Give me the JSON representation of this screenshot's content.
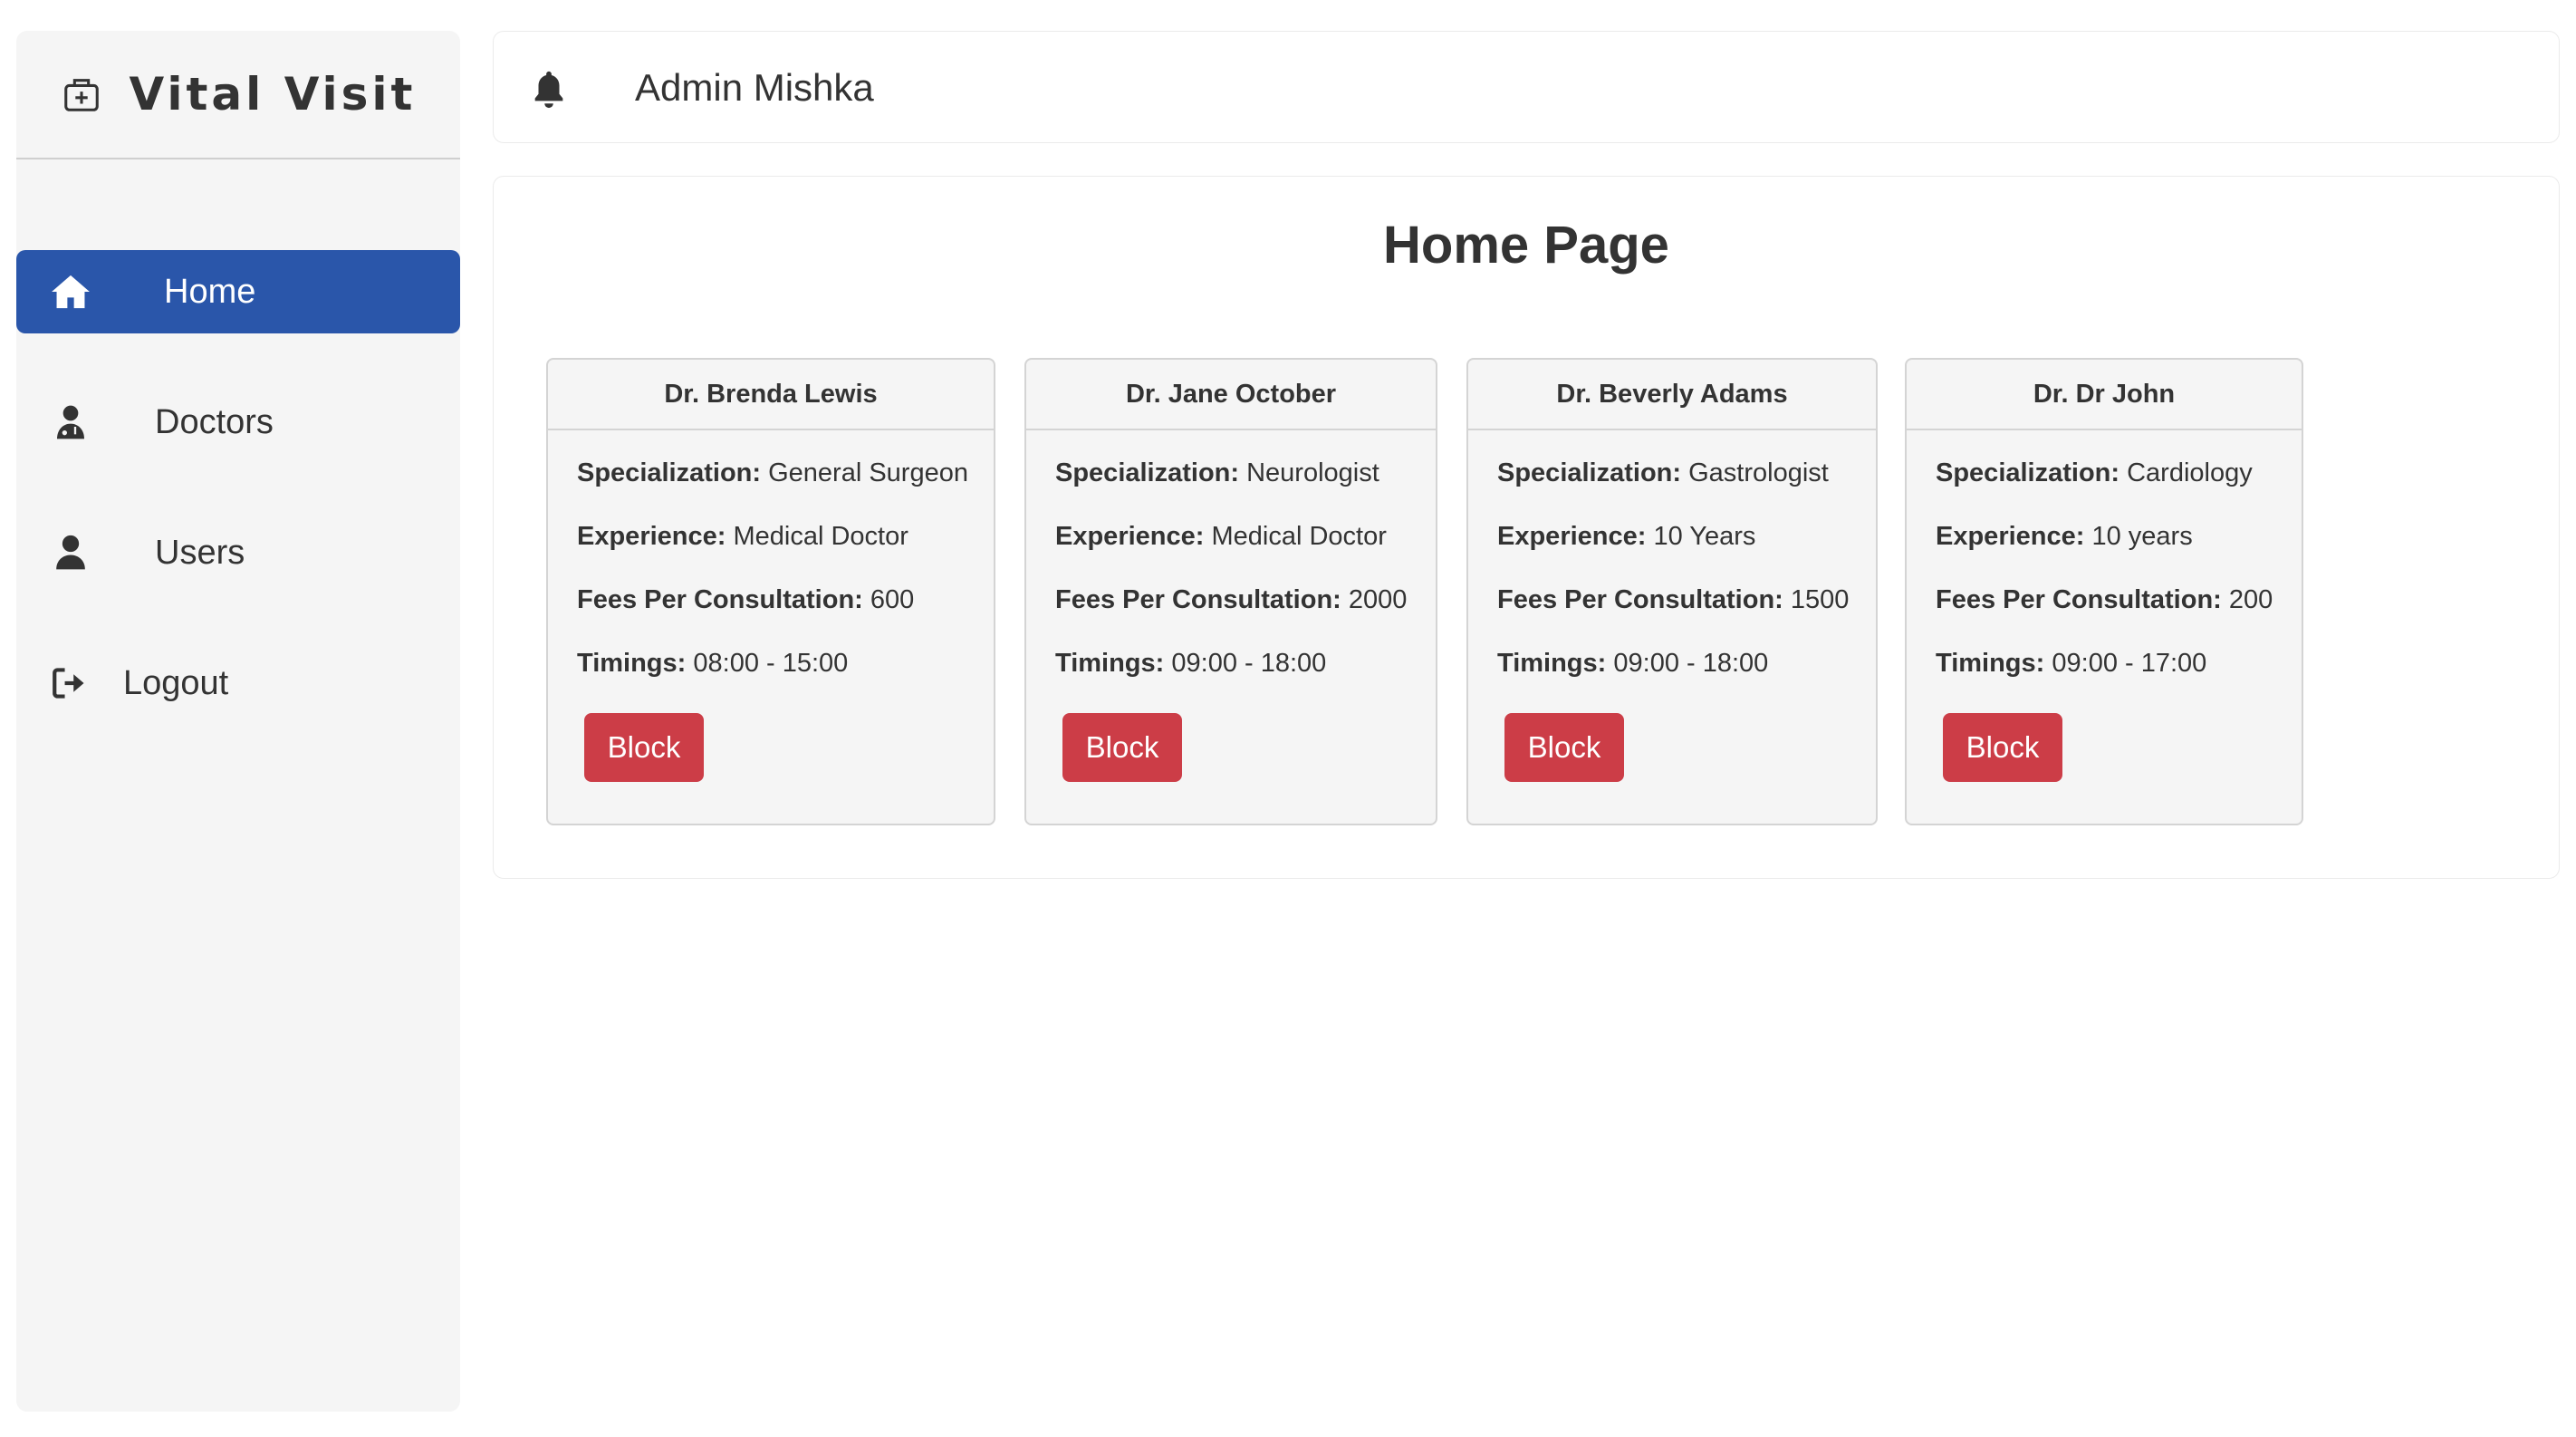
{
  "brand": {
    "name": "Vital Visit"
  },
  "sidebar": {
    "items": [
      {
        "label": "Home"
      },
      {
        "label": "Doctors"
      },
      {
        "label": "Users"
      },
      {
        "label": "Logout"
      }
    ]
  },
  "header": {
    "admin_name": "Admin Mishka"
  },
  "main": {
    "title": "Home Page",
    "labels": {
      "specialization": "Specialization:",
      "experience": "Experience:",
      "fees": "Fees Per Consultation:",
      "timings": "Timings:"
    },
    "block_label": "Block",
    "doctors": [
      {
        "name": "Dr. Brenda Lewis",
        "specialization": "General Surgeon",
        "experience": "Medical Doctor",
        "fees": "600",
        "timings": "08:00 - 15:00"
      },
      {
        "name": "Dr. Jane October",
        "specialization": "Neurologist",
        "experience": "Medical Doctor",
        "fees": "2000",
        "timings": "09:00 - 18:00"
      },
      {
        "name": "Dr. Beverly Adams",
        "specialization": "Gastrologist",
        "experience": "10 Years",
        "fees": "1500",
        "timings": "09:00 - 18:00"
      },
      {
        "name": "Dr. Dr John",
        "specialization": "Cardiology",
        "experience": "10 years",
        "fees": "200",
        "timings": "09:00 - 17:00"
      }
    ]
  },
  "colors": {
    "accent": "#2a56aa",
    "block_button": "#cc3d47",
    "sidebar_bg": "#f5f5f5"
  },
  "icons": [
    "hospital-bag-icon",
    "bell-icon",
    "home-icon",
    "doctor-icon",
    "user-icon",
    "logout-icon"
  ]
}
